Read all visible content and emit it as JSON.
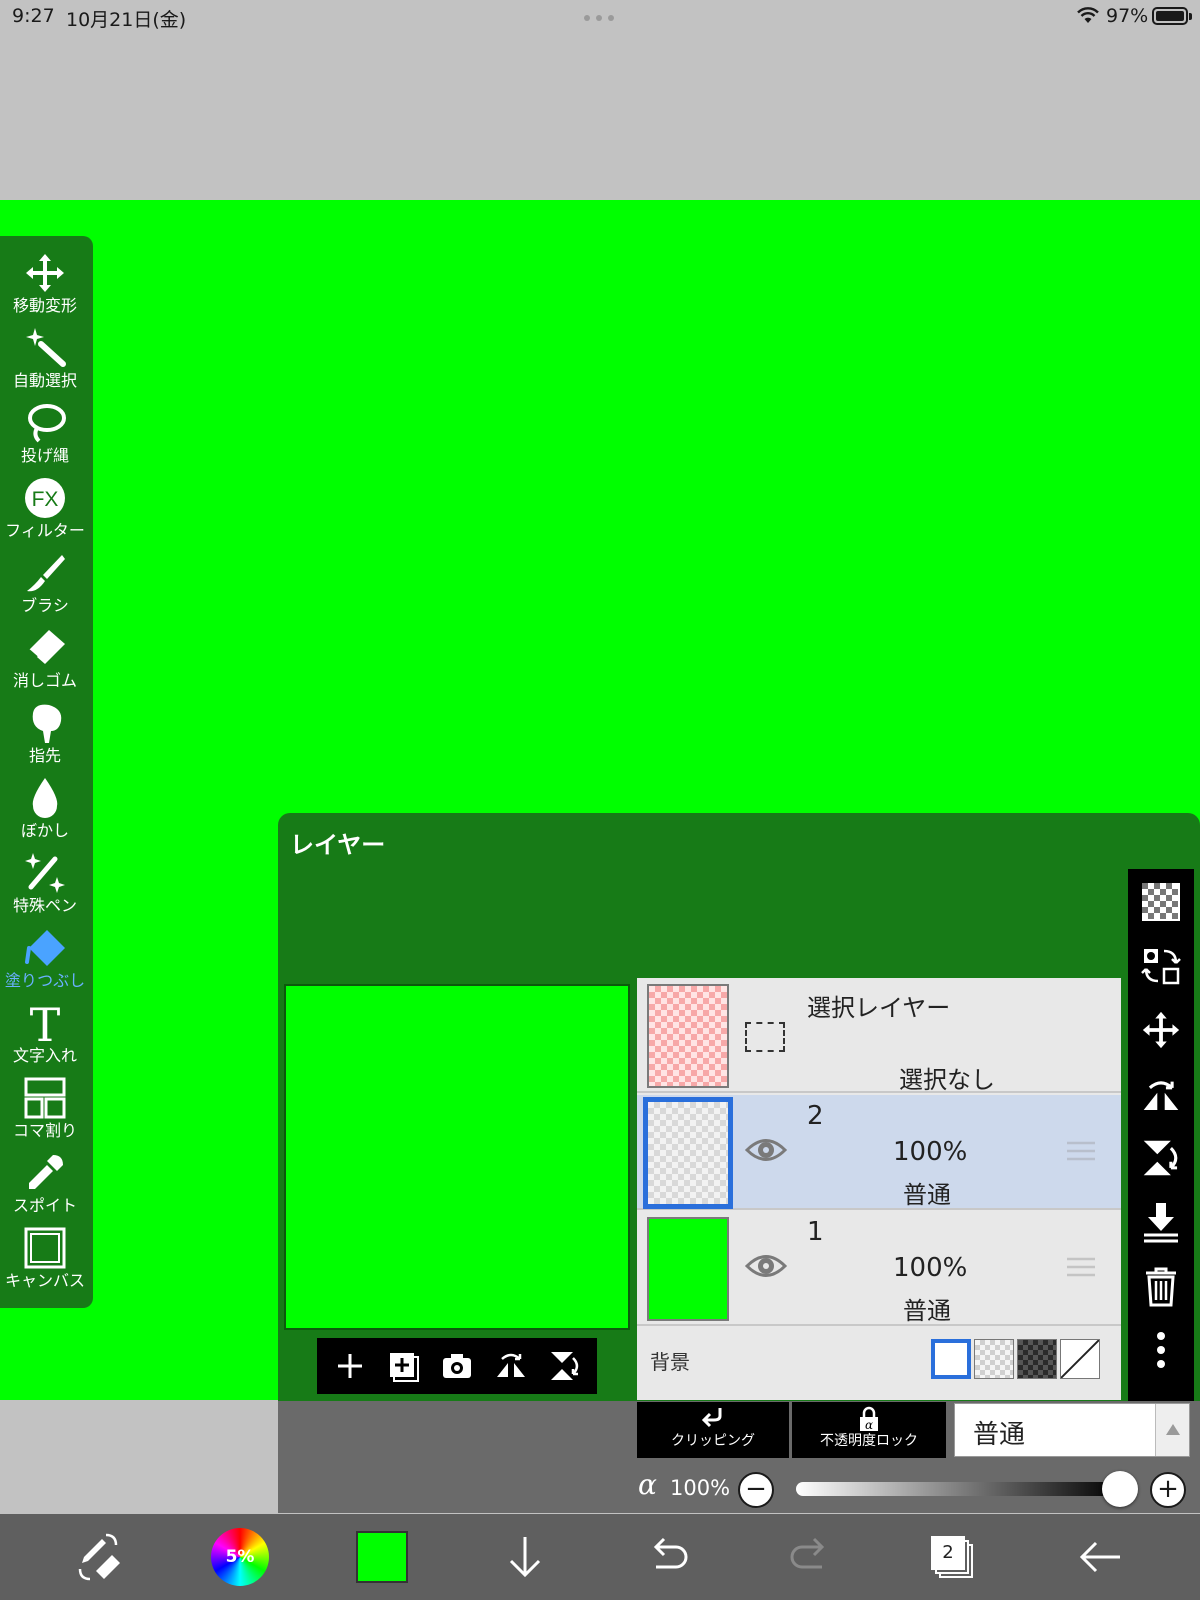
{
  "status": {
    "time": "9:27",
    "date": "10月21日(金)",
    "battery": "97%"
  },
  "canvas_color": "#00ff00",
  "tools": [
    {
      "label": "移動変形",
      "icon": "move-arrows-icon",
      "active": false
    },
    {
      "label": "自動選択",
      "icon": "magic-wand-icon",
      "active": false
    },
    {
      "label": "投げ縄",
      "icon": "lasso-icon",
      "active": false
    },
    {
      "label": "フィルター",
      "icon": "fx-icon",
      "active": false
    },
    {
      "label": "ブラシ",
      "icon": "brush-icon",
      "active": false
    },
    {
      "label": "消しゴム",
      "icon": "eraser-icon",
      "active": false
    },
    {
      "label": "指先",
      "icon": "finger-icon",
      "active": false
    },
    {
      "label": "ぼかし",
      "icon": "blur-drop-icon",
      "active": false
    },
    {
      "label": "特殊ペン",
      "icon": "sparkle-pen-icon",
      "active": false
    },
    {
      "label": "塗りつぶし",
      "icon": "bucket-icon",
      "active": true
    },
    {
      "label": "文字入れ",
      "icon": "text-icon",
      "active": false
    },
    {
      "label": "コマ割り",
      "icon": "frame-divide-icon",
      "active": false
    },
    {
      "label": "スポイト",
      "icon": "eyedropper-icon",
      "active": false
    },
    {
      "label": "キャンバス",
      "icon": "canvas-icon",
      "active": false
    }
  ],
  "layer_panel": {
    "title": "レイヤー",
    "selection_layer": {
      "name": "選択レイヤー",
      "state": "選択なし"
    },
    "layers": [
      {
        "number": "2",
        "opacity": "100%",
        "mode": "普通",
        "selected": true
      },
      {
        "number": "1",
        "opacity": "100%",
        "mode": "普通",
        "selected": false
      }
    ],
    "background_label": "背景",
    "clipping_label": "クリッピング",
    "lock_label": "不透明度ロック",
    "blend_mode": "普通",
    "alpha_symbol": "α",
    "alpha_value": "100%",
    "alpha_fraction": 1.0,
    "minus": "−",
    "plus": "+"
  },
  "bottom": {
    "color_wheel_text": "5%",
    "current_color": "#00ff00",
    "layer_count": "2"
  }
}
